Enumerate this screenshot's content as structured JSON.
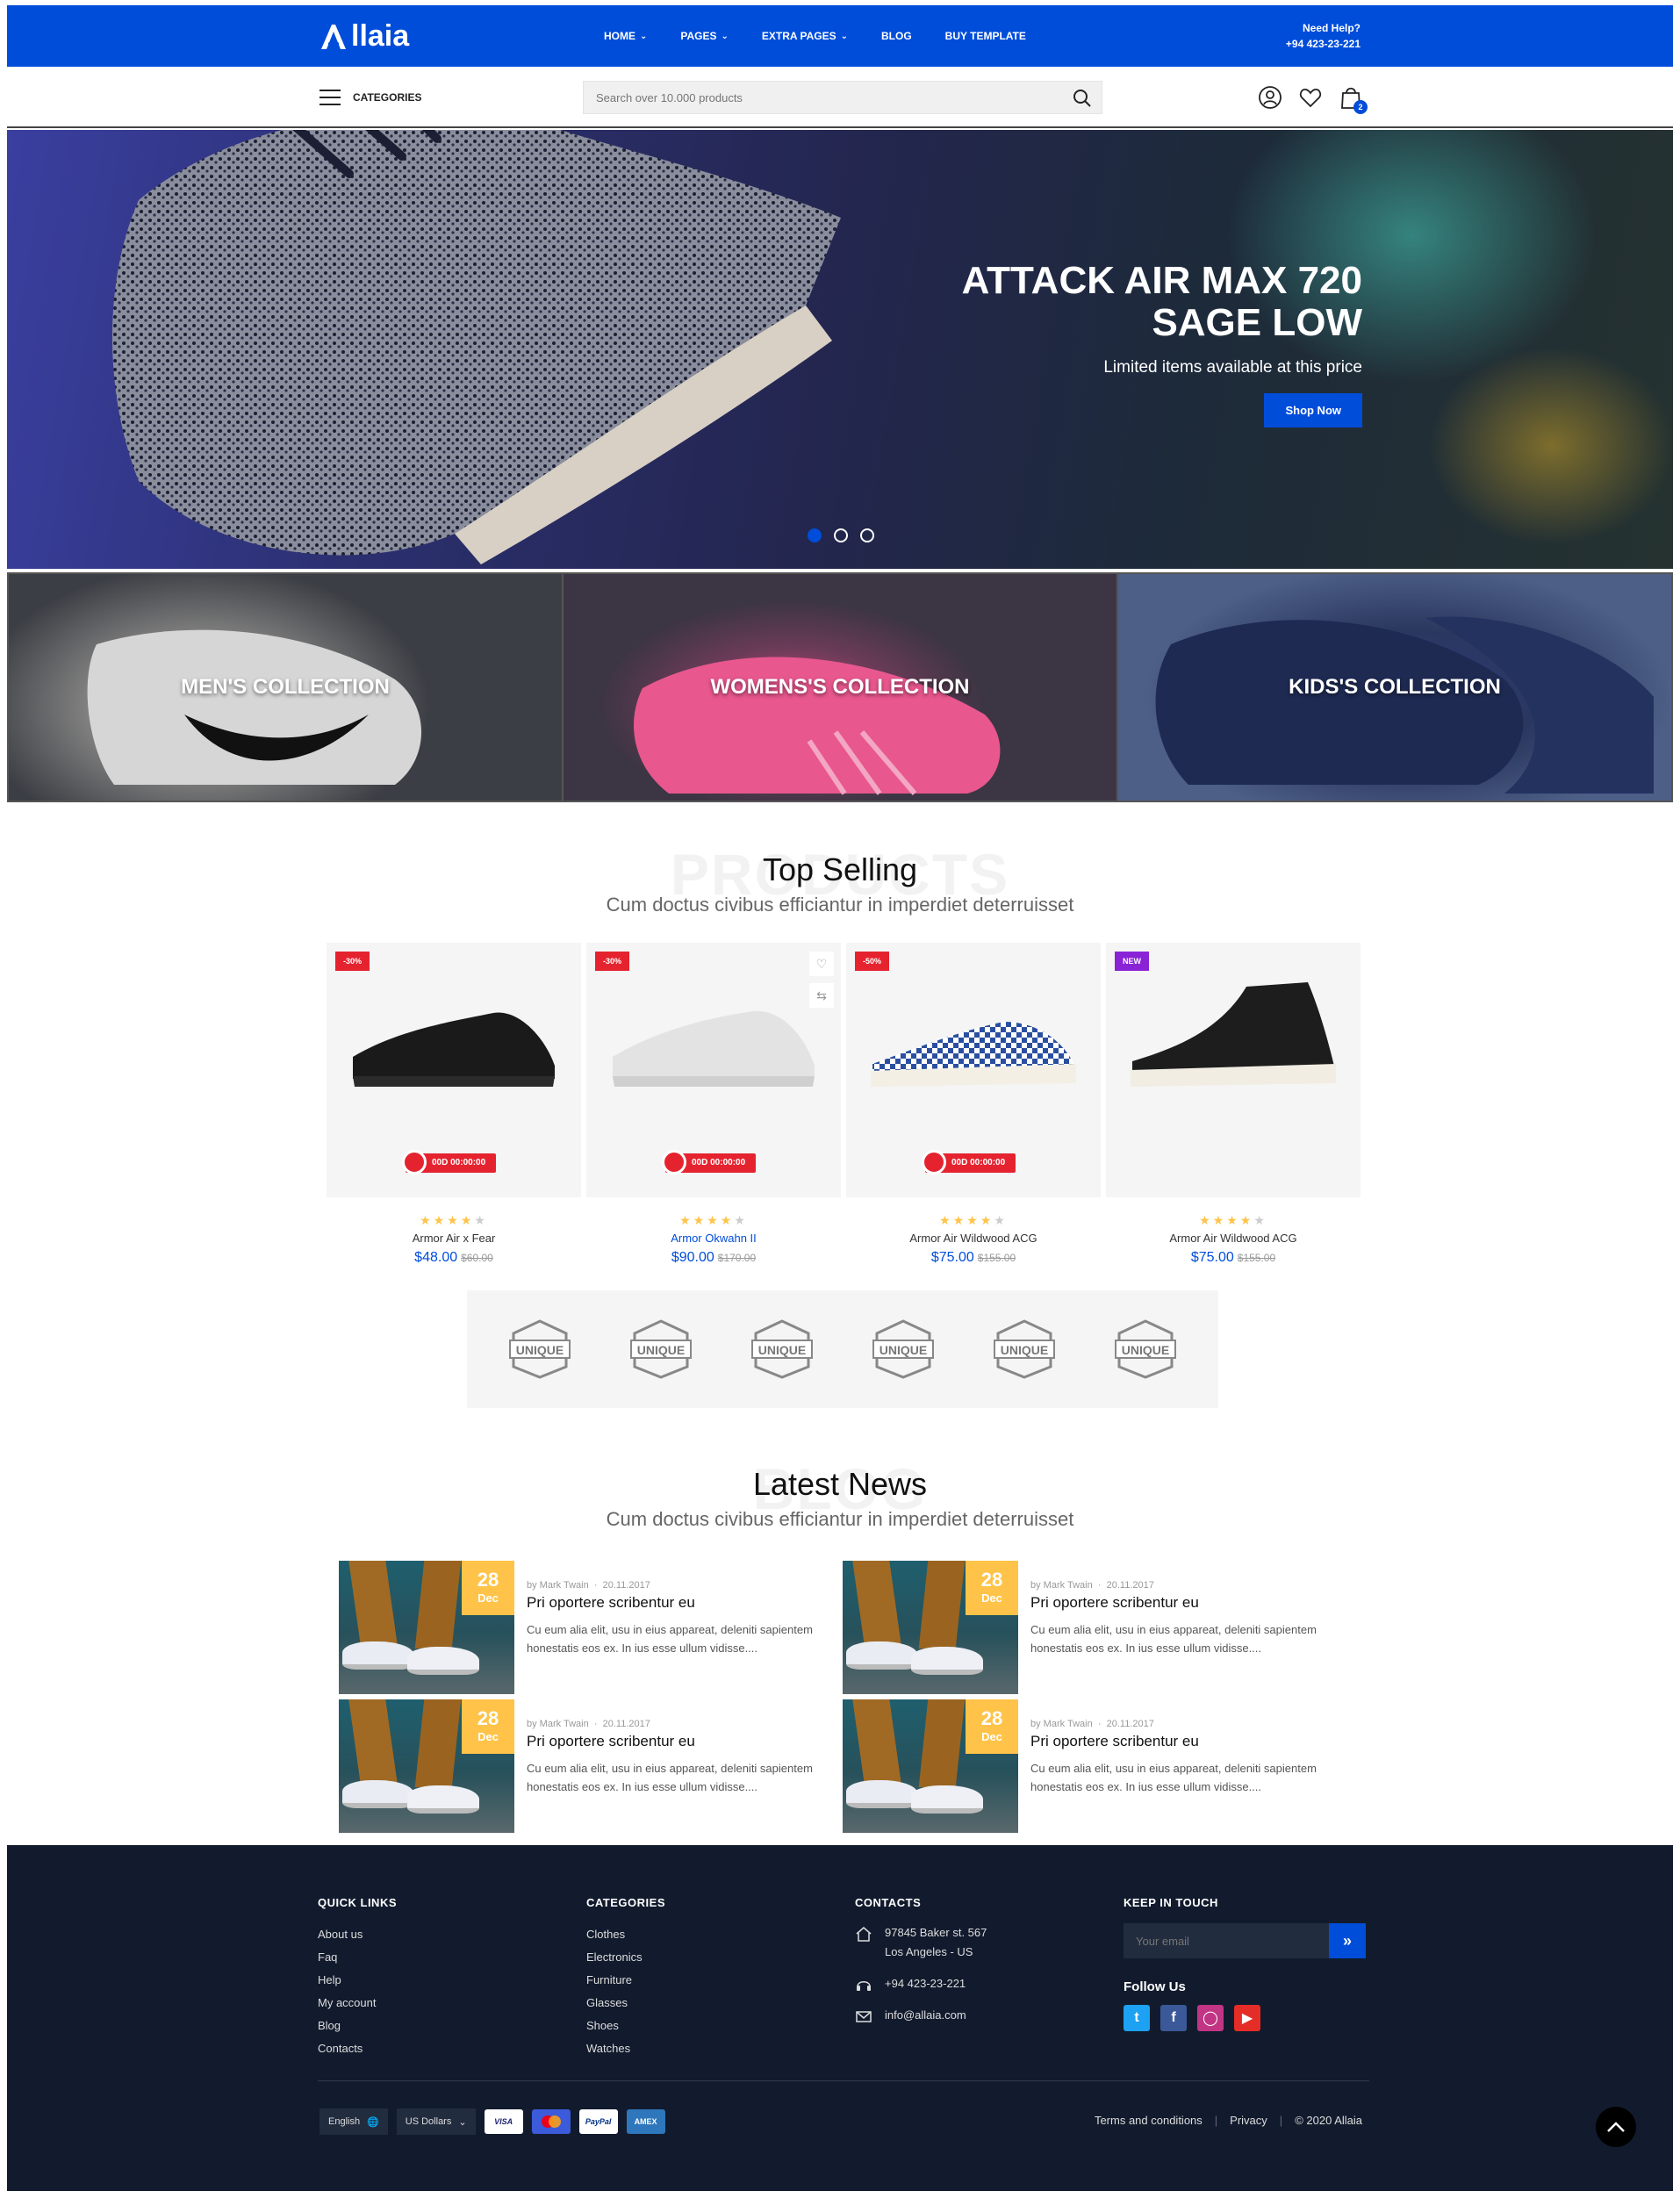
{
  "header": {
    "logo_text": "llaia",
    "nav": [
      {
        "label": "HOME",
        "dropdown": true
      },
      {
        "label": "PAGES",
        "dropdown": true
      },
      {
        "label": "EXTRA PAGES",
        "dropdown": true
      },
      {
        "label": "BLOG",
        "dropdown": false
      },
      {
        "label": "BUY TEMPLATE",
        "dropdown": false
      }
    ],
    "help_label": "Need Help?",
    "help_phone": "+94 423-23-221",
    "categories_label": "CATEGORIES",
    "search_placeholder": "Search over 10.000 products",
    "cart_count": "2",
    "accent_color": "#004dda"
  },
  "hero": {
    "title": "ATTACK AIR MAX 720 SAGE LOW",
    "subtitle": "Limited items available at this price",
    "button": "Shop Now",
    "slides": 3,
    "active_slide": 1
  },
  "collections": [
    {
      "label": "MEN'S COLLECTION"
    },
    {
      "label": "WOMENS'S COLLECTION"
    },
    {
      "label": "KIDS'S COLLECTION"
    }
  ],
  "products_section": {
    "bg_word": "PRODUCTS",
    "title": "Top Selling",
    "subtitle": "Cum doctus civibus efficiantur in imperdiet deterruisset"
  },
  "products": [
    {
      "badge": "-30%",
      "badge_type": "sale",
      "timer": "00D 00:00:00",
      "rating": 4,
      "name": "Armor Air x Fear",
      "price": "$48.00",
      "old_price": "$60.00",
      "highlight": false
    },
    {
      "badge": "-30%",
      "badge_type": "sale",
      "timer": "00D 00:00:00",
      "rating": 4,
      "name": "Armor Okwahn II",
      "price": "$90.00",
      "old_price": "$170.00",
      "highlight": true
    },
    {
      "badge": "-50%",
      "badge_type": "sale",
      "timer": "00D 00:00:00",
      "rating": 4,
      "name": "Armor Air Wildwood ACG",
      "price": "$75.00",
      "old_price": "$155.00",
      "highlight": false
    },
    {
      "badge": "NEW",
      "badge_type": "new",
      "timer": "",
      "rating": 4,
      "name": "Armor Air Wildwood ACG",
      "price": "$75.00",
      "old_price": "$155.00",
      "highlight": false
    }
  ],
  "brands": [
    "UNIQUE",
    "UNIQUE",
    "UNIQUE",
    "UNIQUE",
    "UNIQUE",
    "UNIQUE"
  ],
  "news_section": {
    "bg_word": "BLOG",
    "title": "Latest News",
    "subtitle": "Cum doctus civibus efficiantur in imperdiet deterruisset"
  },
  "news": [
    {
      "day": "28",
      "month": "Dec",
      "author": "by Mark Twain",
      "date": "20.11.2017",
      "title": "Pri oportere scribentur eu",
      "excerpt": "Cu eum alia elit, usu in eius appareat, deleniti sapientem honestatis eos ex. In ius esse ullum vidisse...."
    },
    {
      "day": "28",
      "month": "Dec",
      "author": "by Mark Twain",
      "date": "20.11.2017",
      "title": "Pri oportere scribentur eu",
      "excerpt": "Cu eum alia elit, usu in eius appareat, deleniti sapientem honestatis eos ex. In ius esse ullum vidisse...."
    },
    {
      "day": "28",
      "month": "Dec",
      "author": "by Mark Twain",
      "date": "20.11.2017",
      "title": "Pri oportere scribentur eu",
      "excerpt": "Cu eum alia elit, usu in eius appareat, deleniti sapientem honestatis eos ex. In ius esse ullum vidisse...."
    },
    {
      "day": "28",
      "month": "Dec",
      "author": "by Mark Twain",
      "date": "20.11.2017",
      "title": "Pri oportere scribentur eu",
      "excerpt": "Cu eum alia elit, usu in eius appareat, deleniti sapientem honestatis eos ex. In ius esse ullum vidisse...."
    }
  ],
  "footer": {
    "quick_links_title": "QUICK LINKS",
    "quick_links": [
      "About us",
      "Faq",
      "Help",
      "My account",
      "Blog",
      "Contacts"
    ],
    "categories_title": "CATEGORIES",
    "categories": [
      "Clothes",
      "Electronics",
      "Furniture",
      "Glasses",
      "Shoes",
      "Watches"
    ],
    "contacts_title": "CONTACTS",
    "address_line1": "97845 Baker st. 567",
    "address_line2": "Los Angeles - US",
    "phone": "+94 423-23-221",
    "email": "info@allaia.com",
    "keep_in_touch_title": "KEEP IN TOUCH",
    "email_placeholder": "Your email",
    "follow_title": "Follow Us",
    "social": [
      {
        "name": "twitter",
        "color": "#1da1f2"
      },
      {
        "name": "facebook",
        "color": "#3b5998"
      },
      {
        "name": "instagram",
        "color": "#c13584"
      },
      {
        "name": "youtube",
        "color": "#e52d27"
      }
    ],
    "language": "English",
    "currency": "US Dollars",
    "payment_cards": [
      "VISA",
      "mastercard",
      "PayPal",
      "AMEX"
    ],
    "terms": "Terms and conditions",
    "privacy": "Privacy",
    "copyright": "© 2020 Allaia"
  }
}
